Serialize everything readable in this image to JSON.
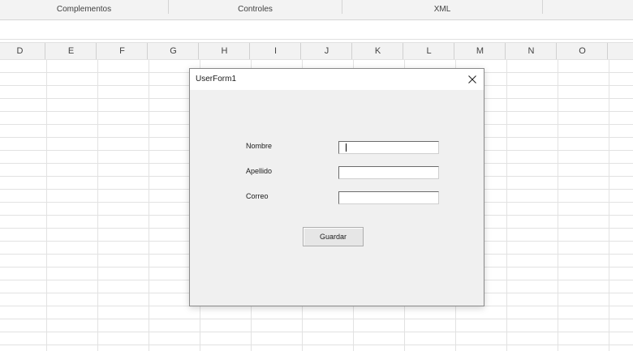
{
  "ribbon": {
    "groups": [
      "Complementos",
      "Controles",
      "XML"
    ]
  },
  "sheet": {
    "columns": [
      "D",
      "E",
      "F",
      "G",
      "H",
      "I",
      "J",
      "K",
      "L",
      "M",
      "N",
      "O"
    ]
  },
  "form": {
    "title": "UserForm1",
    "fields": [
      {
        "label": "Nombre",
        "value": ""
      },
      {
        "label": "Apellido",
        "value": ""
      },
      {
        "label": "Correo",
        "value": ""
      }
    ],
    "button_label": "Guardar"
  }
}
